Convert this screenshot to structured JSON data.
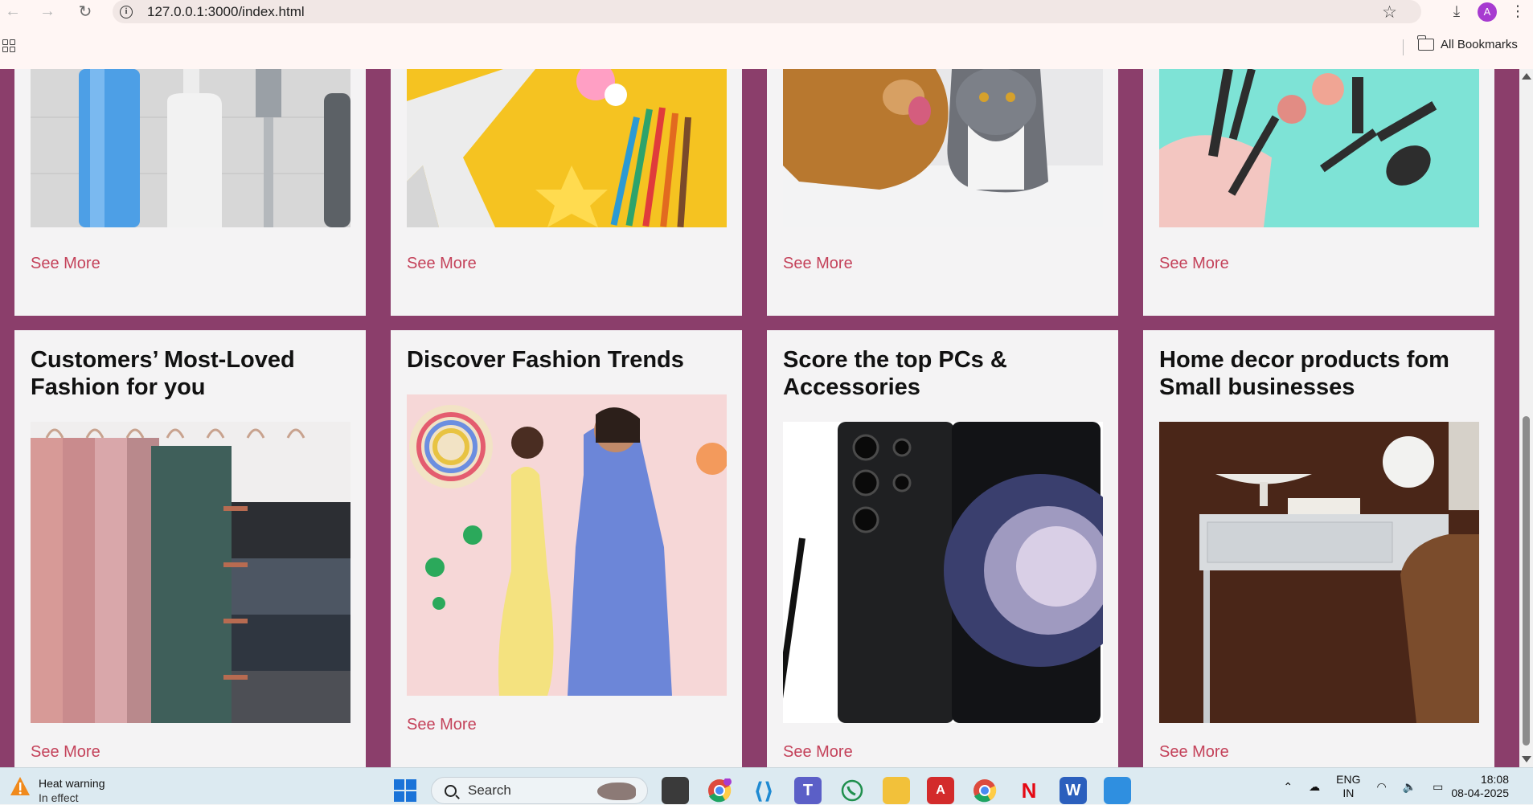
{
  "browser": {
    "url": "127.0.0.1:3000/index.html",
    "avatar_letter": "A",
    "bookmarks_label": "All Bookmarks",
    "icons": {
      "back": "back-arrow-icon",
      "forward": "forward-arrow-icon",
      "reload": "reload-icon",
      "site_info": "info-icon",
      "bookmark": "star-icon",
      "downloads": "download-icon",
      "menu": "kebab-menu-icon",
      "apps": "apps-grid-icon",
      "folder": "folder-icon"
    }
  },
  "cards_top": [
    {
      "see_more": "See More",
      "image": "toiletries-razor"
    },
    {
      "see_more": "See More",
      "image": "toys-pencils"
    },
    {
      "see_more": "See More",
      "image": "dog-and-cat"
    },
    {
      "see_more": "See More",
      "image": "makeup-brushes"
    }
  ],
  "cards_bottom": [
    {
      "title": "Customers’ Most-Loved Fashion for you",
      "see_more": "See More",
      "image": "hanging-scarves"
    },
    {
      "title": "Discover Fashion Trends",
      "see_more": "See More",
      "image": "fashion-models"
    },
    {
      "title": "Score the top PCs & Accessories",
      "see_more": "See More",
      "image": "samsung-phone"
    },
    {
      "title": "Home decor products fom Small businesses",
      "see_more": "See More",
      "image": "desk-decor"
    }
  ],
  "colors": {
    "page_background": "#8b3e6b",
    "card_background": "#f4f3f4",
    "link": "#c4425a"
  },
  "taskbar": {
    "weather_title": "Heat warning",
    "weather_sub": "In effect",
    "search_label": "Search",
    "lang_top": "ENG",
    "lang_bottom": "IN",
    "time": "18:08",
    "date": "08-04-2025",
    "apps": [
      "file-manager",
      "chrome",
      "vscode",
      "teams",
      "whatsapp",
      "file-explorer",
      "acrobat",
      "chrome-profile",
      "netflix",
      "word",
      "photos"
    ]
  }
}
